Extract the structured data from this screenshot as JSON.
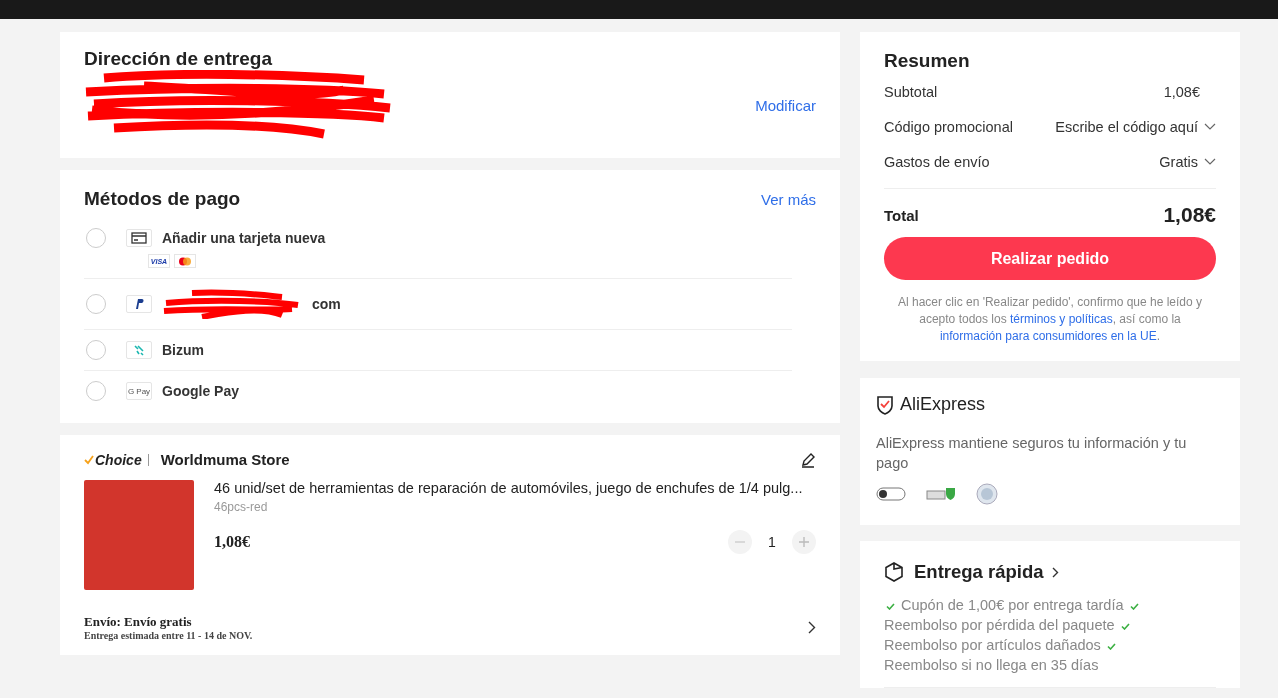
{
  "delivery": {
    "title": "Dirección de entrega",
    "edit_link": "Modificar"
  },
  "payment": {
    "title": "Métodos de pago",
    "more_link": "Ver más",
    "methods": [
      {
        "kind": "card",
        "label": "Añadir una tarjeta nueva",
        "selected": false,
        "brands": [
          "VISA"
        ]
      },
      {
        "kind": "paypal",
        "label": "com",
        "selected": false
      },
      {
        "kind": "bizum",
        "label": "Bizum",
        "selected": false
      },
      {
        "kind": "googlepay",
        "label": "Google Pay",
        "icon_text": "G Pay",
        "selected": false
      }
    ]
  },
  "order": {
    "badge": "Choice",
    "store": "Worldmuma Store",
    "product": {
      "title": "46 unid/set de herramientas de reparación de automóviles, juego de enchufes de 1/4 pulg...",
      "variant": "46pcs-red",
      "price": "1,08€",
      "quantity": "1"
    },
    "shipping": "Envío: Envío gratis",
    "estimate": "Entrega estimada entre **11 - 14 de NOV.**"
  },
  "summary": {
    "title": "Resumen",
    "rows": [
      {
        "label": "Subtotal",
        "value": "1,08€",
        "dropdown": false
      },
      {
        "label": "Código promocional",
        "value": "Escribe el código aquí",
        "dropdown": true
      },
      {
        "label": "Gastos de envío",
        "value": "Gratis",
        "dropdown": true
      }
    ],
    "total_label": "Total",
    "total_value": "1,08€",
    "button": "Realizar pedido",
    "legal": [
      {
        "kind": "text",
        "text": "Al hacer clic en 'Realizar pedido', confirmo que he leído y acepto todos los "
      },
      {
        "kind": "link",
        "text": "términos y políticas"
      },
      {
        "kind": "text",
        "text": ", así como la "
      },
      {
        "kind": "link",
        "text": "información para consumidores en la UE"
      },
      {
        "kind": "text",
        "text": "."
      }
    ]
  },
  "security": {
    "brand": "AliExpress",
    "text": "AliExpress mantiene seguros tu información y tu pago"
  },
  "fast_delivery": {
    "title": "Entrega rápida",
    "perks": [
      "Cupón de 1,00€ por entrega tardía",
      "Reembolso por pérdida del paquete",
      "Reembolso por artículos dañados",
      "Reembolso si no llega en 35 días"
    ]
  }
}
